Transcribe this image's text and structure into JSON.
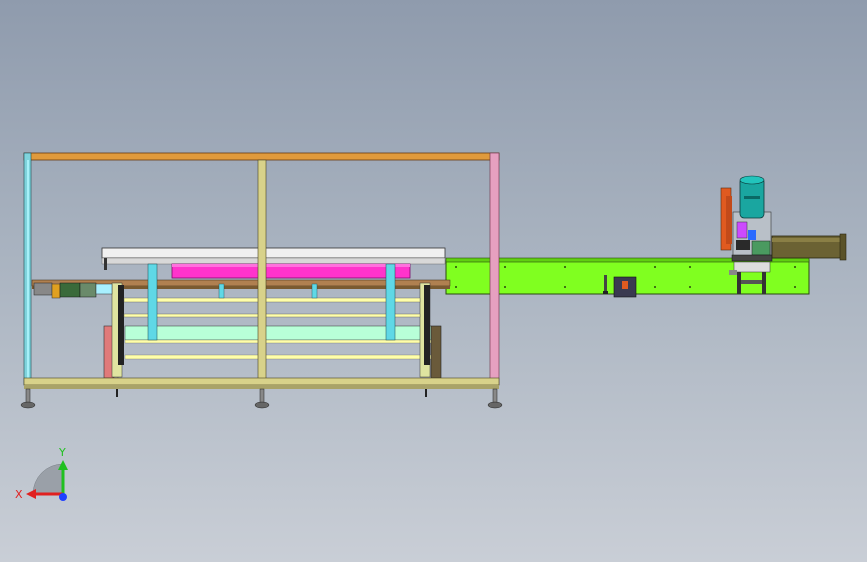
{
  "viewport": {
    "colors": {
      "frame_orange": "#e09a3c",
      "frame_cyan": "#7fd3dc",
      "frame_pink": "#e6a0c0",
      "frame_yellow": "#d8d28a",
      "conveyor_green": "#80ff20",
      "platen_magenta": "#ff33cc",
      "motor_teal": "#1aa6a0",
      "tube_olive": "#6b6233"
    }
  },
  "triad": {
    "x_label": "X",
    "y_label": "Y",
    "x_color": "#e02020",
    "y_color": "#20c020",
    "z_color": "#2040ff"
  }
}
